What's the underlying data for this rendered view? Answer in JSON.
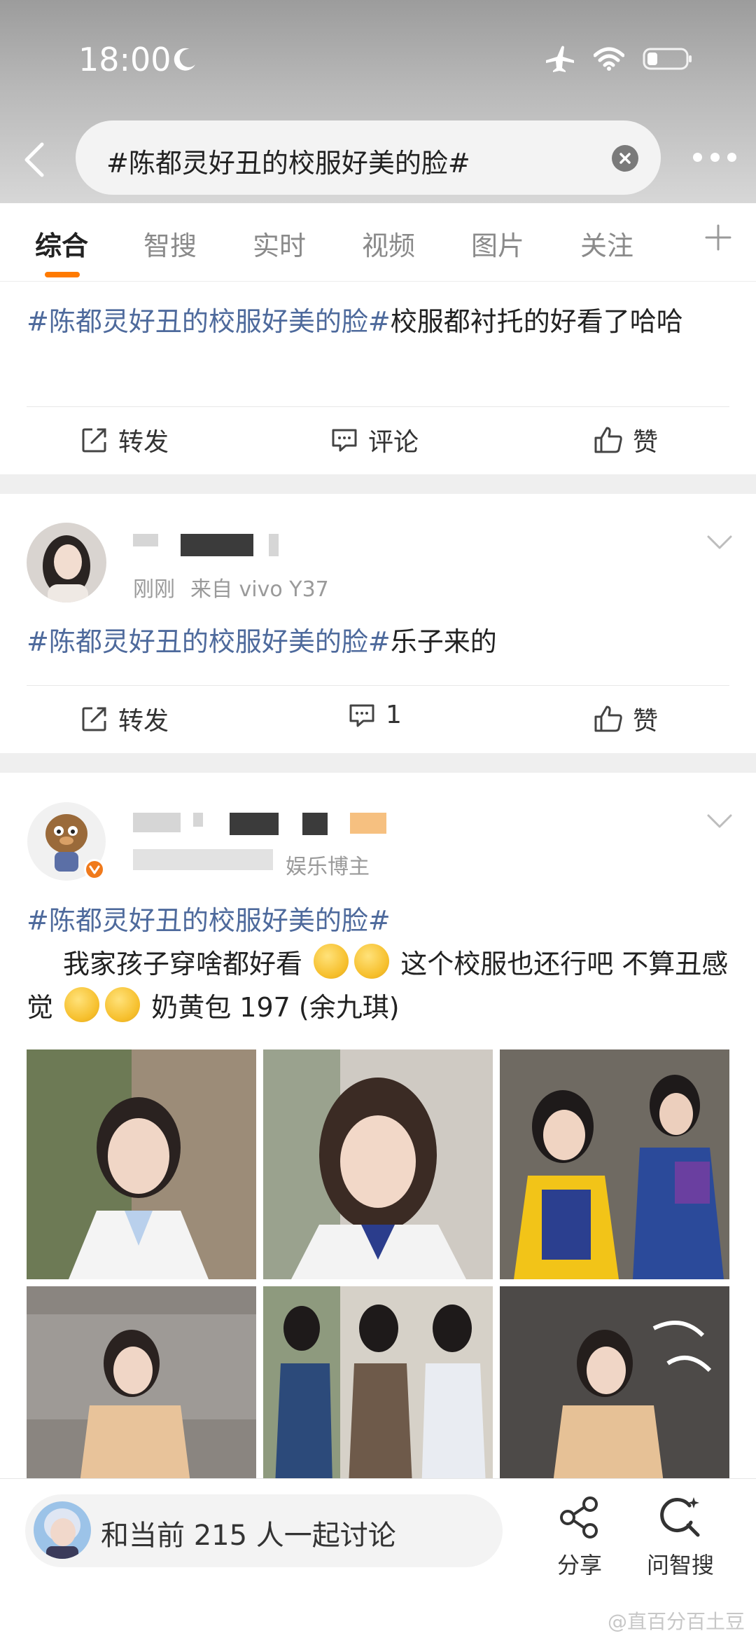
{
  "status_bar": {
    "time": "18:00"
  },
  "search": {
    "query": "#陈都灵好丑的校服好美的脸#"
  },
  "tabs": [
    "综合",
    "智搜",
    "实时",
    "视频",
    "图片",
    "关注"
  ],
  "post1": {
    "tag": "#陈都灵好丑的校服好美的脸#",
    "text": "校服都衬托的好看了哈哈",
    "repost": "转发",
    "comment": "评论",
    "like": "赞"
  },
  "post2": {
    "time": "刚刚",
    "source": "来自 vivo Y37",
    "tag": "#陈都灵好丑的校服好美的脸#",
    "text": "乐子来的",
    "repost": "转发",
    "comment_count": "1",
    "like": "赞"
  },
  "post3": {
    "badge": "娱乐博主",
    "tag": "#陈都灵好丑的校服好美的脸#",
    "text_a": "我家孩子穿啥都好看",
    "text_b": "这个校服也还行吧 不算丑感觉",
    "text_c": "奶黄包 197 (余九琪)"
  },
  "bottom": {
    "discuss": "和当前 215 人一起讨论",
    "share": "分享",
    "ask": "问智搜",
    "watermark": "@直百分百土豆"
  },
  "colors": {
    "accent": "#ff7a00",
    "link": "#4e6a9c",
    "verified": "#f07a1c"
  }
}
